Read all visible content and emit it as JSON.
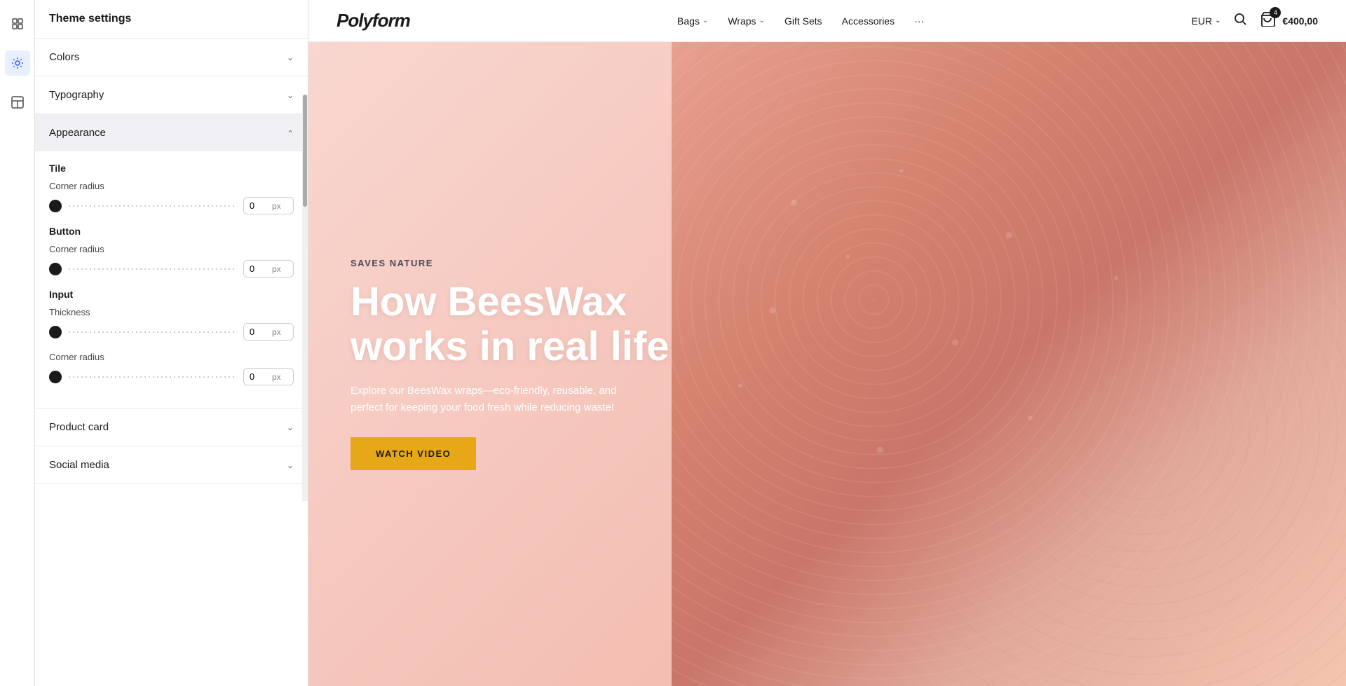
{
  "app": {
    "title": "Theme settings"
  },
  "toolbar": {
    "icons": [
      {
        "name": "grid-icon",
        "label": "Grid",
        "active": false
      },
      {
        "name": "settings-icon",
        "label": "Settings",
        "active": true
      },
      {
        "name": "layout-icon",
        "label": "Layout",
        "active": false
      }
    ]
  },
  "settings": {
    "header": "Theme settings",
    "sections": [
      {
        "id": "colors",
        "label": "Colors",
        "expanded": false,
        "active": false
      },
      {
        "id": "typography",
        "label": "Typography",
        "expanded": false,
        "active": false
      },
      {
        "id": "appearance",
        "label": "Appearance",
        "expanded": true,
        "active": true,
        "subsections": [
          {
            "id": "tile",
            "label": "Tile",
            "fields": [
              {
                "id": "tile-corner-radius",
                "label": "Corner radius",
                "value": "0",
                "unit": "px"
              }
            ]
          },
          {
            "id": "button",
            "label": "Button",
            "fields": [
              {
                "id": "button-corner-radius",
                "label": "Corner radius",
                "value": "0",
                "unit": "px"
              }
            ]
          },
          {
            "id": "input",
            "label": "Input",
            "fields": [
              {
                "id": "input-thickness",
                "label": "Thickness",
                "value": "0",
                "unit": "px"
              },
              {
                "id": "input-corner-radius",
                "label": "Corner radius",
                "value": "0",
                "unit": "px"
              }
            ]
          }
        ]
      },
      {
        "id": "product-card",
        "label": "Product card",
        "expanded": false,
        "active": false
      },
      {
        "id": "social-media",
        "label": "Social media",
        "expanded": false,
        "active": false
      }
    ]
  },
  "store": {
    "logo": "Polyform",
    "nav": [
      {
        "label": "Bags",
        "hasDropdown": true
      },
      {
        "label": "Wraps",
        "hasDropdown": true
      },
      {
        "label": "Gift Sets",
        "hasDropdown": false
      },
      {
        "label": "Accessories",
        "hasDropdown": false
      },
      {
        "label": "···",
        "hasDropdown": false
      }
    ],
    "currency": "EUR",
    "cart": {
      "count": "4",
      "price": "€400,00"
    }
  },
  "hero": {
    "tagline": "SAVES NATURE",
    "title": "How BeesWax works in real life",
    "description": "Explore our BeesWax wraps—eco-friendly, reusable, and perfect for keeping your food fresh while reducing waste!",
    "cta": "WATCH VIDEO"
  }
}
